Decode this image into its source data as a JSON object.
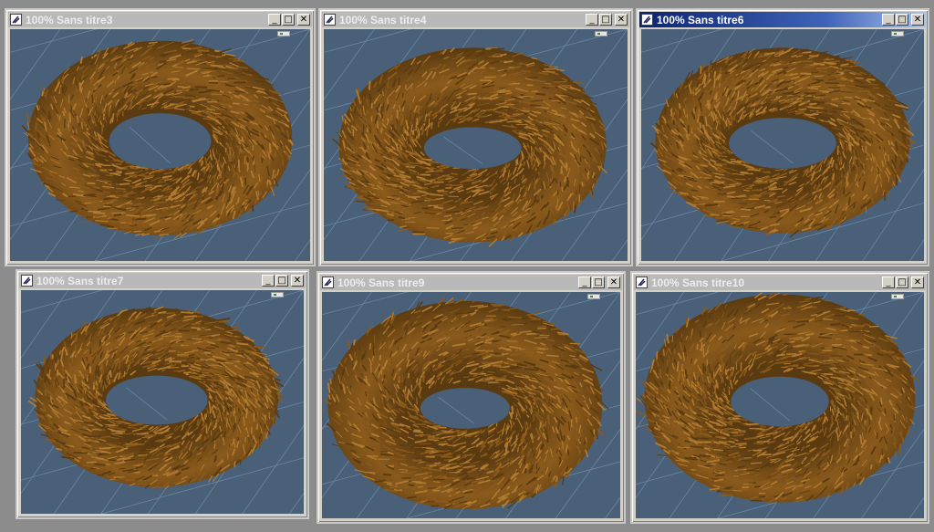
{
  "windows": [
    {
      "title": "100% Sans titre3",
      "active": false
    },
    {
      "title": "100% Sans titre4",
      "active": false
    },
    {
      "title": "100% Sans titre6",
      "active": true
    },
    {
      "title": "100% Sans titre7",
      "active": false
    },
    {
      "title": "100% Sans titre9",
      "active": false
    },
    {
      "title": "100% Sans titre10",
      "active": false
    }
  ],
  "controls": {
    "minimize": "_",
    "maximize": "□",
    "close": "✕"
  },
  "colors": {
    "desktop": "#8c8c8c",
    "viewport": "#4a5f78",
    "grid": "#7fa9c4",
    "fur_dark": "#5a3a10",
    "fur_mid": "#8a5a1c",
    "fur_light": "#b07a30",
    "active_title": "#0b2470"
  },
  "icons": [
    "app-icon",
    "minimize-icon",
    "maximize-icon",
    "close-icon"
  ]
}
